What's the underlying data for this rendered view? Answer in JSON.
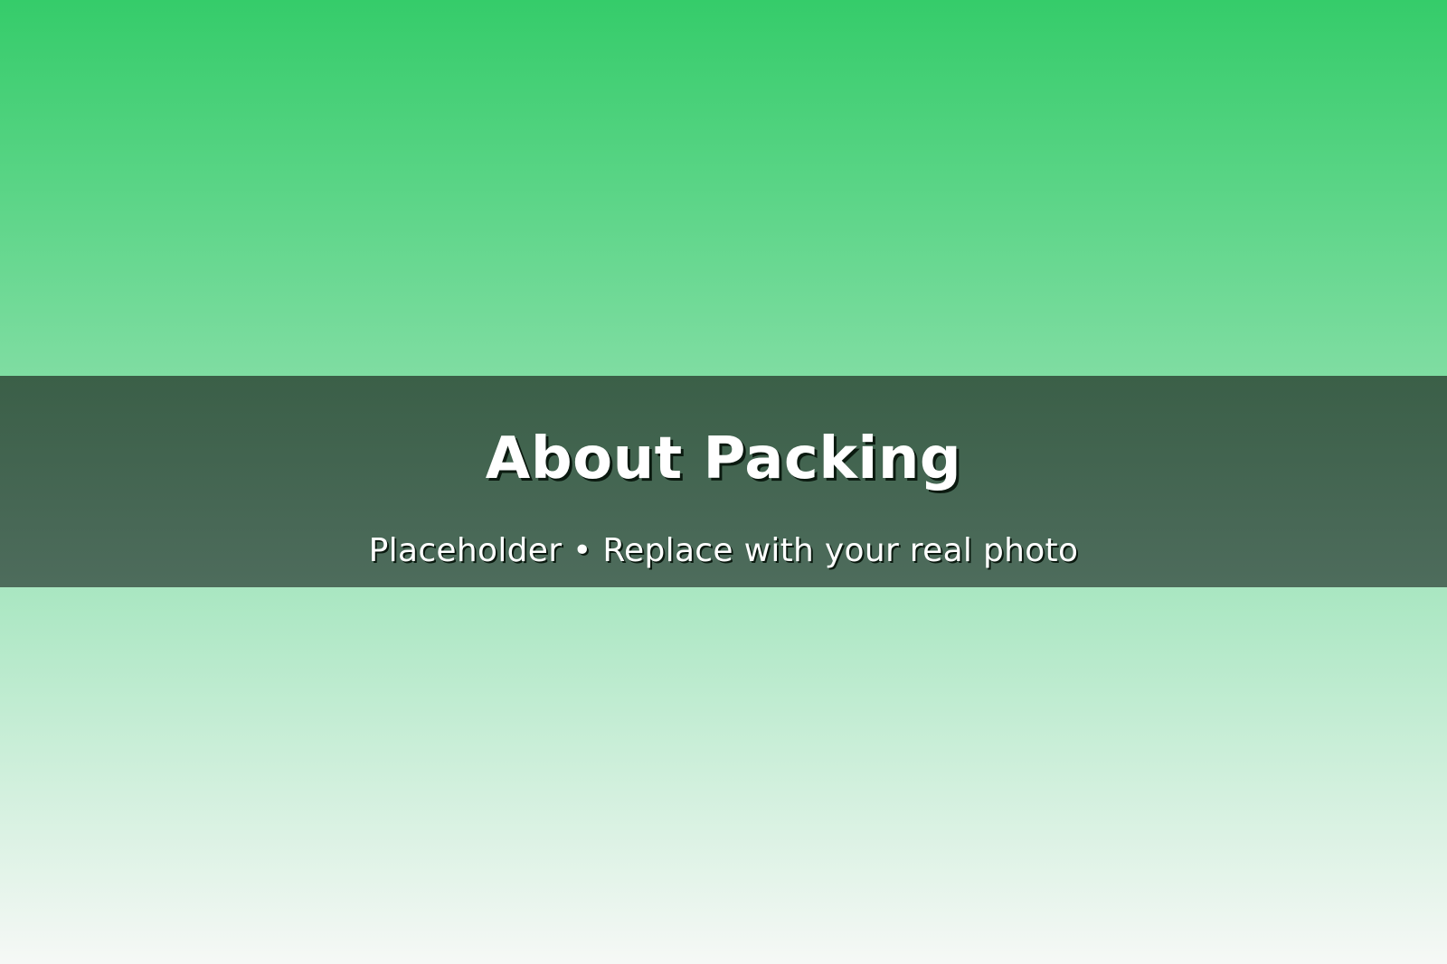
{
  "banner": {
    "title": "About Packing",
    "subtitle": "Placeholder • Replace with your real photo"
  },
  "colors": {
    "gradient_top": "#35cc6a",
    "gradient_mid": "#a7e6c0",
    "gradient_bottom": "#f6f8f6",
    "band": "#3f634c",
    "text": "#ffffff"
  }
}
